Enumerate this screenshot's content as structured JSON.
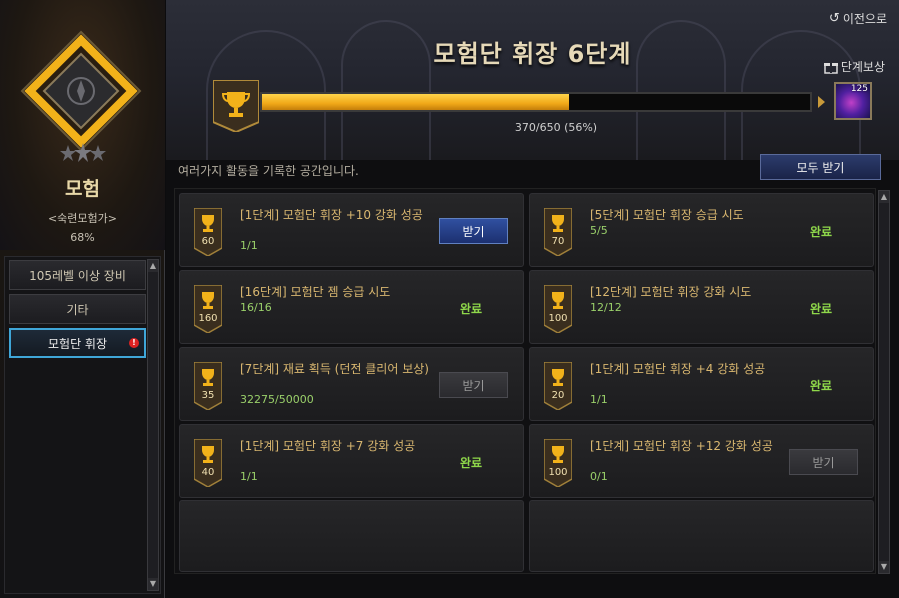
{
  "sidebar": {
    "category_title": "모험",
    "category_subtitle": "<숙련모험가>",
    "category_percent": "68%",
    "items": [
      {
        "label": "105레벨 이상 장비"
      },
      {
        "label": "기타"
      },
      {
        "label": "모험단 휘장"
      }
    ],
    "alert_mark": "!"
  },
  "header": {
    "back_label": "이전으로",
    "title": "모험단 휘장 6단계",
    "reward_label": "단계보상",
    "progress_text": "370/650 (56%)",
    "progress_fraction": 0.56,
    "reward_item_count": "125"
  },
  "content": {
    "description": "여러가지 활동을 기록한 공간입니다.",
    "claim_all_label": "모두 받기",
    "achievements": [
      {
        "points": "60",
        "title": "[1단계] 모험단 휘장 +10 강화 성공",
        "progress": "1/1",
        "status": "claim",
        "action_label": "받기"
      },
      {
        "points": "70",
        "title": "[5단계] 모험단 휘장 승급 시도",
        "progress": "5/5",
        "status": "done",
        "action_label": "완료"
      },
      {
        "points": "160",
        "title": "[16단계] 모험단 젬 승급 시도",
        "progress": "16/16",
        "status": "done",
        "action_label": "완료"
      },
      {
        "points": "100",
        "title": "[12단계] 모험단 휘장 강화 시도",
        "progress": "12/12",
        "status": "done",
        "action_label": "완료"
      },
      {
        "points": "35",
        "title": "[7단계] 재료 획득 (던전 클리어 보상)",
        "progress": "32275/50000",
        "status": "disabled",
        "action_label": "받기"
      },
      {
        "points": "20",
        "title": "[1단계] 모험단 휘장 +4 강화 성공",
        "progress": "1/1",
        "status": "done",
        "action_label": "완료"
      },
      {
        "points": "40",
        "title": "[1단계] 모험단 휘장 +7 강화 성공",
        "progress": "1/1",
        "status": "done",
        "action_label": "완료"
      },
      {
        "points": "100",
        "title": "[1단계] 모험단 휘장 +12 강화 성공",
        "progress": "0/1",
        "status": "disabled",
        "action_label": "받기"
      }
    ]
  },
  "colors": {
    "accent_gold": "#f0a818",
    "done_green": "#8fd84a",
    "active_border": "#3fa6d8",
    "claim_blue": "#2c3c6c"
  },
  "icons": {
    "back": "back-arrow-icon",
    "reward": "gift-icon",
    "trophy": "trophy-icon",
    "emblem": "compass-emblem-icon"
  }
}
